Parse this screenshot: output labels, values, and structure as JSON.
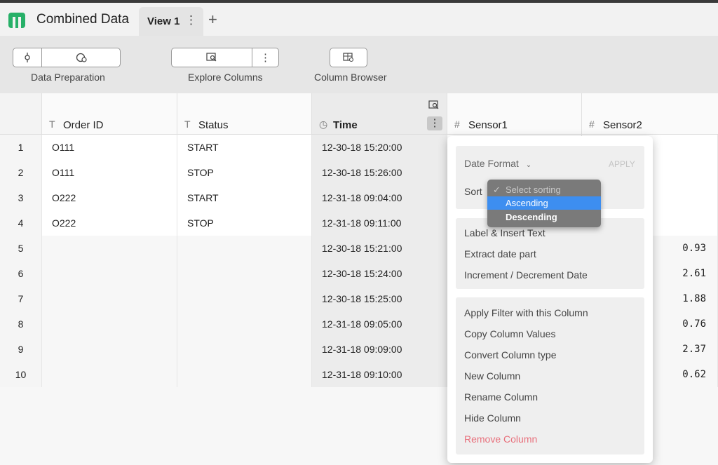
{
  "app": {
    "title": "Combined Data"
  },
  "tabs": [
    {
      "label": "View 1",
      "menu": "⋮"
    }
  ],
  "add_tab": "+",
  "toolbar": {
    "data_preparation": "Data Preparation",
    "explore_columns": "Explore Columns",
    "explore_menu": "⋮",
    "column_browser": "Column Browser"
  },
  "table": {
    "columns": [
      {
        "label": "Order ID",
        "type_icon": "T"
      },
      {
        "label": "Status",
        "type_icon": "T"
      },
      {
        "label": "Time",
        "type_icon": "◷"
      },
      {
        "label": "Sensor1",
        "type_icon": "#"
      },
      {
        "label": "Sensor2",
        "type_icon": "#"
      }
    ],
    "rows": [
      {
        "n": "1",
        "order": "O111",
        "status": "START",
        "time": "12-30-18 15:20:00",
        "s2": ""
      },
      {
        "n": "2",
        "order": "O111",
        "status": "STOP",
        "time": "12-30-18 15:26:00",
        "s2": ""
      },
      {
        "n": "3",
        "order": "O222",
        "status": "START",
        "time": "12-31-18 09:04:00",
        "s2": ""
      },
      {
        "n": "4",
        "order": "O222",
        "status": "STOP",
        "time": "12-31-18 09:11:00",
        "s2": ""
      },
      {
        "n": "5",
        "order": "",
        "status": "",
        "time": "12-30-18 15:21:00",
        "s2": "0.93"
      },
      {
        "n": "6",
        "order": "",
        "status": "",
        "time": "12-30-18 15:24:00",
        "s2": "2.61"
      },
      {
        "n": "7",
        "order": "",
        "status": "",
        "time": "12-30-18 15:25:00",
        "s2": "1.88"
      },
      {
        "n": "8",
        "order": "",
        "status": "",
        "time": "12-31-18 09:05:00",
        "s2": "0.76"
      },
      {
        "n": "9",
        "order": "",
        "status": "",
        "time": "12-31-18 09:09:00",
        "s2": "2.37"
      },
      {
        "n": "10",
        "order": "",
        "status": "",
        "time": "12-31-18 09:10:00",
        "s2": "0.62"
      }
    ]
  },
  "column_menu": {
    "date_format": "Date Format",
    "apply": "APPLY",
    "sort_label": "Sort",
    "sort_options": [
      "Select sorting",
      "Ascending",
      "Descending"
    ],
    "sort_highlighted": "Ascending",
    "group1": [
      "Label & Insert Text",
      "Extract date part",
      "Increment / Decrement Date"
    ],
    "group2": [
      "Apply Filter with this Column",
      "Copy Column Values",
      "Convert Column type",
      "New Column",
      "Rename Column",
      "Hide Column"
    ],
    "remove": "Remove Column",
    "colors": {
      "remove": "#e8707c",
      "highlight": "#3d8ef0"
    }
  }
}
